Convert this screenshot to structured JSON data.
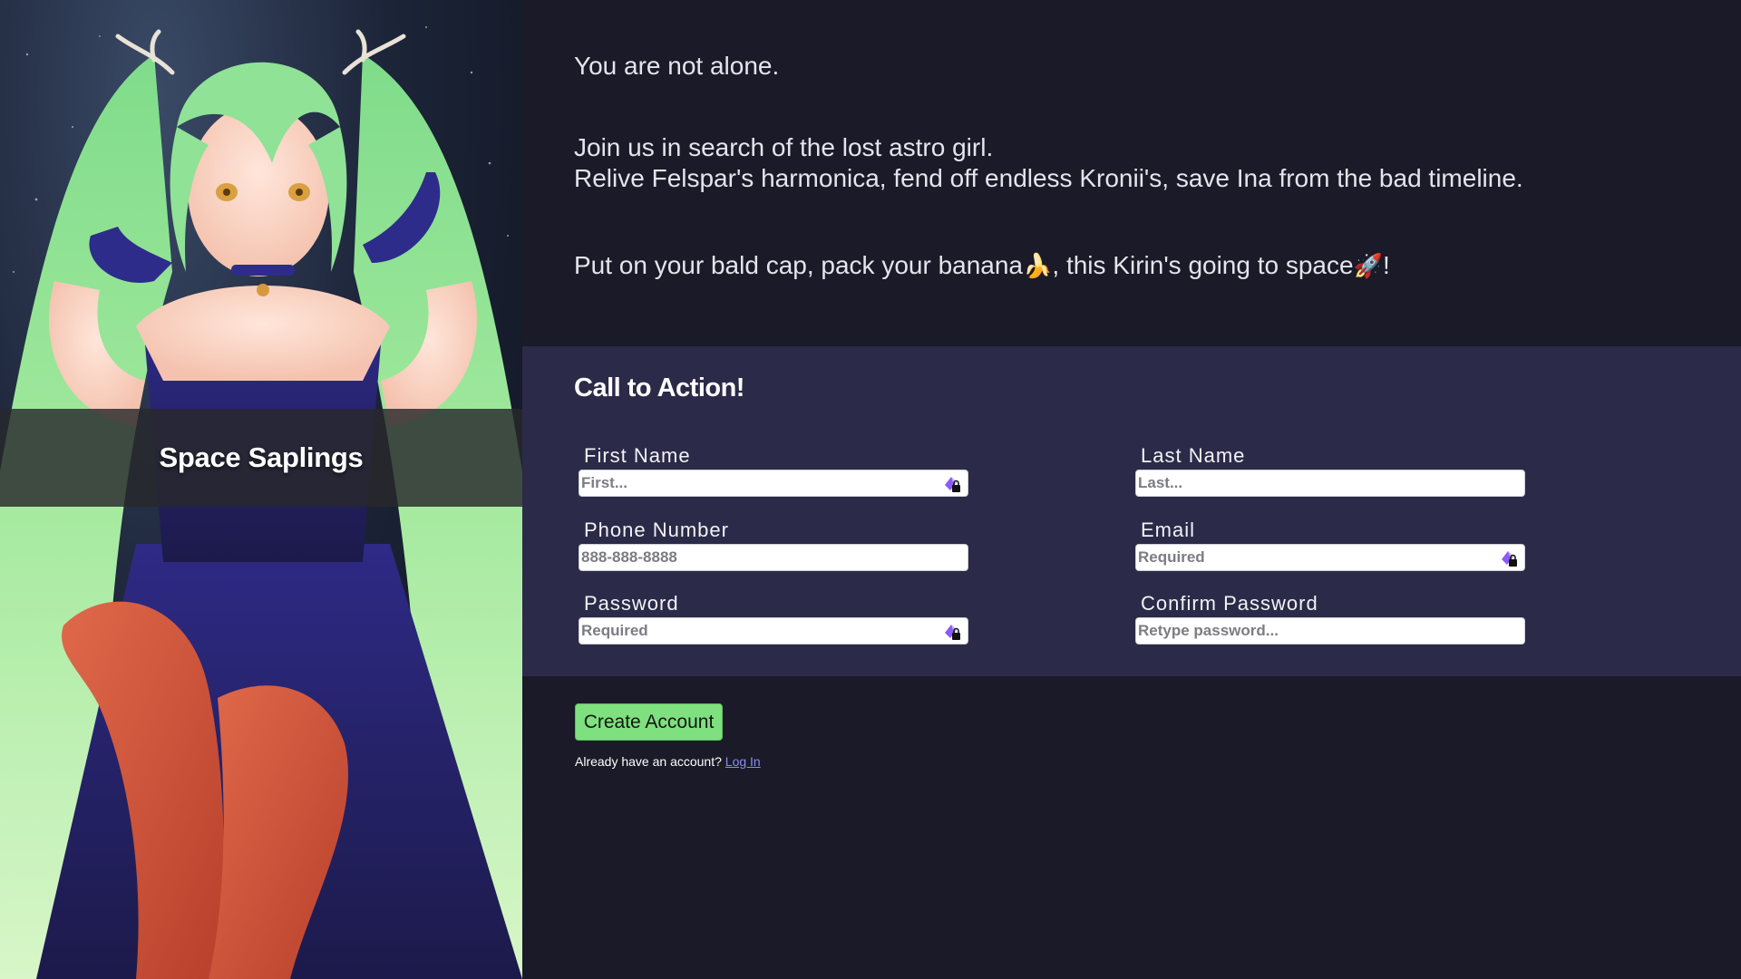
{
  "hero": {
    "title": "Space Saplings",
    "image": "green-haired-anime-girl-in-blue-dress"
  },
  "intro": {
    "line1": "You are not alone.",
    "line2": "Join us in search of the lost astro girl.",
    "line3": "Relive Felspar's harmonica, fend off endless Kronii's, save Ina from the bad timeline.",
    "line4_a": "Put on your bald cap, pack your banana",
    "line4_emoji1": "🍌",
    "line4_b": ", this Kirin's going to space",
    "line4_emoji2": "🚀",
    "line4_c": "!"
  },
  "form": {
    "heading": "Call to Action!",
    "fields": {
      "first_name": {
        "label": "First Name",
        "placeholder": "First...",
        "value": "",
        "has_password_manager_icon": true
      },
      "last_name": {
        "label": "Last Name",
        "placeholder": "Last...",
        "value": "",
        "has_password_manager_icon": false
      },
      "phone": {
        "label": "Phone Number",
        "placeholder": "888-888-8888",
        "value": "",
        "has_password_manager_icon": false
      },
      "email": {
        "label": "Email",
        "placeholder": "Required",
        "value": "",
        "has_password_manager_icon": true
      },
      "password": {
        "label": "Password",
        "placeholder": "Required",
        "value": "",
        "has_password_manager_icon": true
      },
      "confirm_password": {
        "label": "Confirm Password",
        "placeholder": "Retype password...",
        "value": "",
        "has_password_manager_icon": false
      }
    }
  },
  "actions": {
    "create_label": "Create Account",
    "login_prompt": "Already have an account?",
    "login_link": "Log In"
  },
  "colors": {
    "page_bg": "#1a1a28",
    "form_bg": "#2b2a48",
    "button_bg": "#7ee07e",
    "link": "#8a8ef0"
  }
}
